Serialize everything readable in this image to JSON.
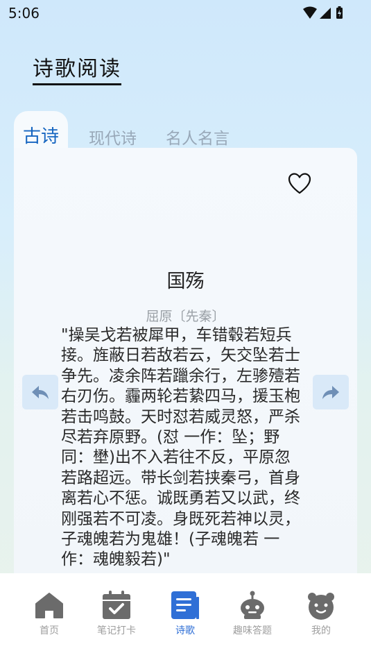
{
  "status": {
    "time": "5:06"
  },
  "page": {
    "title": "诗歌阅读"
  },
  "tabs": [
    {
      "label": "古诗",
      "active": true
    },
    {
      "label": "现代诗",
      "active": false
    },
    {
      "label": "名人名言",
      "active": false
    }
  ],
  "poem": {
    "title": "国殇",
    "author": "屈原〔先秦〕",
    "body": "\"操吴戈若被犀甲，车错毂若短兵接。旌蔽日若敌若云，矢交坠若士争先。凌余阵若躐余行，左骖殪若右刃伤。霾两轮若絷四马，援玉枹若击鸣鼓。天时怼若威灵怒，严杀尽若弃原野。(怼 一作：坠；野 同：壄)出不入若往不反，平原忽若路超远。带长剑若挟秦弓，首身离若心不惩。诚既勇若又以武，终刚强若不可凌。身既死若神以灵，子魂魄若为鬼雄！(子魂魄若 一作：魂魄毅若)\""
  },
  "bottom_nav": [
    {
      "label": "首页",
      "icon": "home-icon",
      "active": false
    },
    {
      "label": "笔记打卡",
      "icon": "calendar-check-icon",
      "active": false
    },
    {
      "label": "诗歌",
      "icon": "document-icon",
      "active": true
    },
    {
      "label": "趣味答题",
      "icon": "robot-icon",
      "active": false
    },
    {
      "label": "我的",
      "icon": "bear-face-icon",
      "active": false
    }
  ],
  "colors": {
    "accent": "#2f6fd6",
    "inactive": "#9e9e9e",
    "icon_inactive": "#6b6b6b"
  }
}
